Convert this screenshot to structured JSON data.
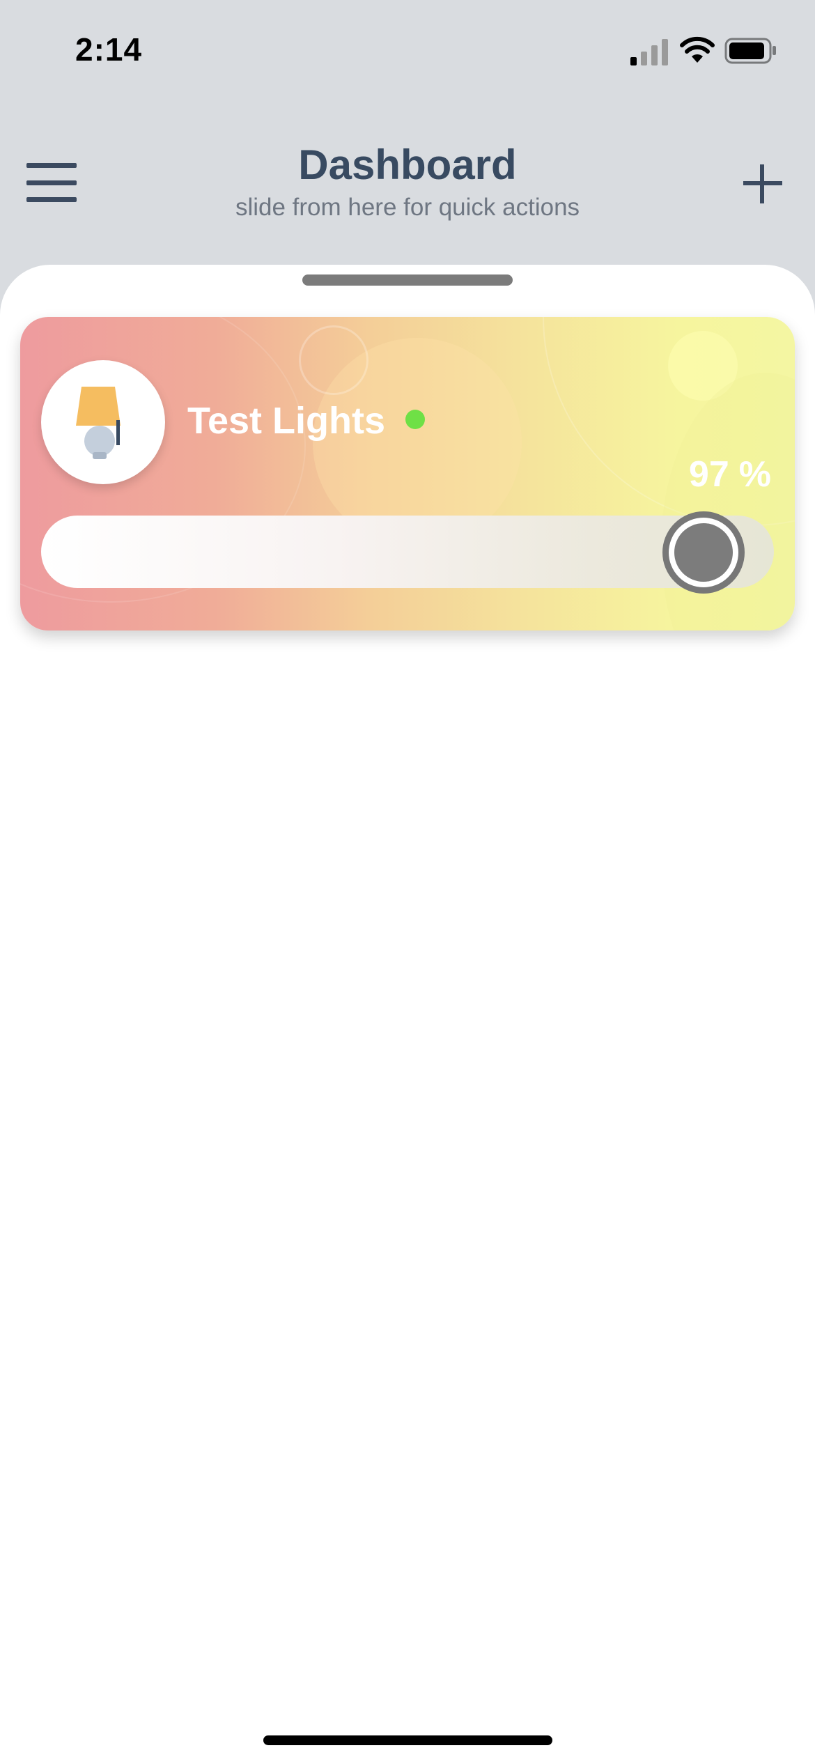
{
  "status_bar": {
    "time": "2:14",
    "signal_icon": "cellular-signal-icon",
    "wifi_icon": "wifi-icon",
    "battery_icon": "battery-icon"
  },
  "header": {
    "title": "Dashboard",
    "subtitle": "slide from here for quick actions",
    "menu_icon": "hamburger-menu-icon",
    "add_icon": "plus-icon"
  },
  "device_card": {
    "name": "Test Lights",
    "icon": "table-lamp-icon",
    "online": true,
    "brightness_value": "97",
    "brightness_unit": "%",
    "brightness_fraction": 0.97,
    "colors": {
      "gradient_start": "#ee9b9e",
      "gradient_end": "#f4f6a2",
      "online_dot": "#6fe046"
    }
  }
}
